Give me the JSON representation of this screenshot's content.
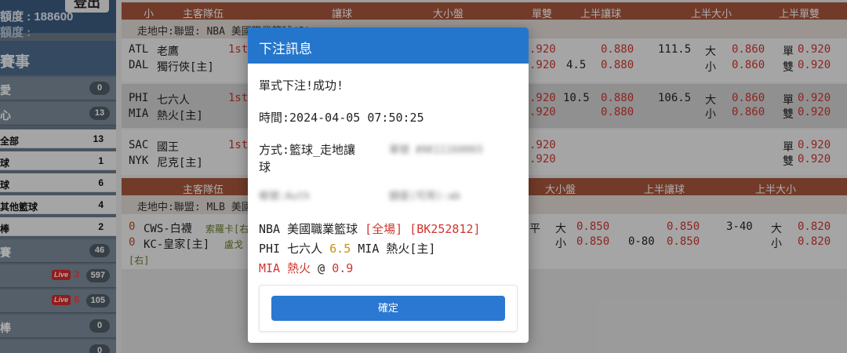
{
  "sidebar": {
    "account_label": "額度 : 188600",
    "account_label2": "額度 :",
    "logout": "登出",
    "section_title": "賽事",
    "categories": [
      {
        "label": "愛",
        "count": "0"
      },
      {
        "label": "心",
        "count": "13"
      }
    ],
    "sub_items": [
      {
        "label": "全部",
        "count": "13"
      },
      {
        "label": "球",
        "count": "1"
      },
      {
        "label": "球",
        "count": "6"
      },
      {
        "label": "其他籃球",
        "count": "4"
      },
      {
        "label": "棒",
        "count": "2"
      }
    ],
    "more_categories": [
      {
        "label": "賽",
        "count": "46"
      },
      {
        "label": "",
        "live": "Live",
        "live_count": "3",
        "count": "597"
      },
      {
        "label": "",
        "live": "Live",
        "live_count": "6",
        "count": "105"
      },
      {
        "label": "棒",
        "count": "0"
      },
      {
        "label": "",
        "count": "0"
      }
    ]
  },
  "table": {
    "header1": [
      "小",
      "主客隊伍",
      "讓球",
      "大小盤",
      "單雙",
      "上半讓球",
      "上半大小",
      "上半單雙"
    ],
    "league1": "走地中:聯盟: NBA 美國職業籃球(3)",
    "games": [
      {
        "home_code": "ATL",
        "home": "老鷹",
        "away_code": "DAL",
        "away": "獨行俠[主]",
        "period": "1st",
        "odd1": ".920",
        "odd2": ".920",
        "hcap": "4.5",
        "hodds1": "0.880",
        "hodds2": "0.880",
        "total": "111.5",
        "big": "大",
        "small": "小",
        "bodds1": "0.860",
        "bodds2": "0.860",
        "odd_lbl": "單",
        "even_lbl": "雙",
        "oe1": "0.920",
        "oe2": "0.920"
      },
      {
        "home_code": "PHI",
        "home": "七六人",
        "away_code": "MIA",
        "away": "熱火[主]",
        "period": "1st",
        "odd1": ".920",
        "odd2": ".920",
        "hcap": "10.5",
        "hodds1": "0.880",
        "hodds2": "0.880",
        "total": "106.5",
        "big": "大",
        "small": "小",
        "bodds1": "0.860",
        "bodds2": "0.860",
        "odd_lbl": "單",
        "even_lbl": "雙",
        "oe1": "0.920",
        "oe2": "0.920"
      },
      {
        "home_code": "SAC",
        "home": "國王",
        "away_code": "NYK",
        "away": "尼克[主]",
        "period": "1st",
        "odd1": ".920",
        "odd2": ".920",
        "odd_lbl": "單",
        "even_lbl": "雙",
        "oe1": "0.920",
        "oe2": "0.920"
      }
    ],
    "header2": [
      "主客隊伍",
      "大小盤",
      "上半讓球",
      "上半大小"
    ],
    "league2": "走地中:聯盟: MLB 美國",
    "mlb": {
      "score1": "0",
      "team1": "CWS-白襪",
      "pitcher1": "索羅卡[右",
      "score2": "0",
      "team2": "KC-皇家[主]",
      "pitcher2": "盧戈",
      "note": "[右]",
      "flat": "平",
      "big": "大",
      "small": "小",
      "ou1": "0.850",
      "ou2": "0.850",
      "hline": "0-80",
      "h1": "0.850",
      "h2": "0.850",
      "hou_line": "3-40",
      "hou_big": "大",
      "hou_small": "小",
      "hou1": "0.820",
      "hou2": "0.820"
    }
  },
  "modal": {
    "title": "下注訊息",
    "success": "單式下注!成功!",
    "time": "時間:2024-04-05 07:50:25",
    "method": "方式:籃球_走地讓",
    "method_cont": "球",
    "blur1": "單號 #AK11160065",
    "blur2": "帳號:Auth",
    "blur3": "額度(可用):ab",
    "line1_a": "NBA 美國職業籃球 ",
    "line1_b": "[全場]",
    "line1_c": " ",
    "line1_d": "[BK252812]",
    "line2_a": "PHI 七六人 ",
    "line2_b": "6.5",
    "line2_c": " MIA 熱火[主]",
    "line3_a": "MIA 熱火",
    "line3_b": " @ ",
    "line3_c": "0.9",
    "confirm": "確定"
  },
  "colors": {
    "header_bg": "#a9583d",
    "modal_header": "#2476cc",
    "button": "#2b78d2",
    "odds_red": "#d0352f"
  }
}
